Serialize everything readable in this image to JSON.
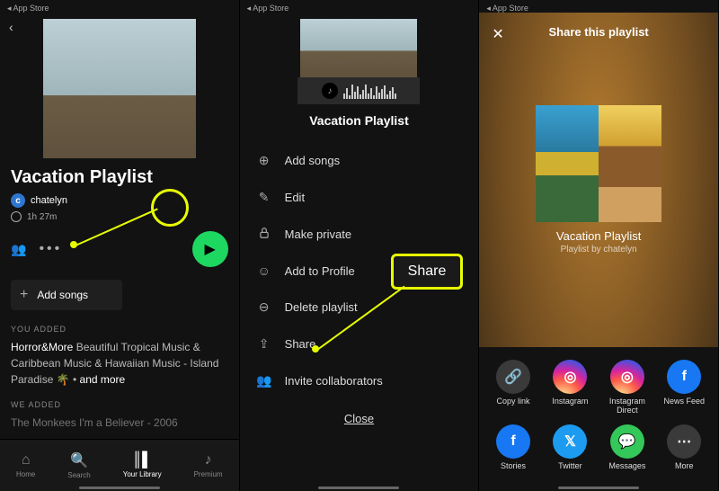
{
  "status_bar": "App Store",
  "screen1": {
    "title": "Vacation Playlist",
    "author_initial": "c",
    "author": "chatelyn",
    "duration": "1h 27m",
    "add_songs": "Add songs",
    "you_added": "YOU ADDED",
    "track1_name": "Horror&More",
    "track1_rest": "Beautiful Tropical Music & Caribbean Music & Hawaiian Music - Island Paradise 🌴  • ",
    "and_more": "and more",
    "we_added": "WE ADDED",
    "track2": "The Monkees I'm a Believer - 2006",
    "tabs": {
      "home": "Home",
      "search": "Search",
      "library": "Your Library",
      "premium": "Premium"
    }
  },
  "screen2": {
    "title": "Vacation Playlist",
    "add_songs": "Add songs",
    "edit": "Edit",
    "make_private": "Make private",
    "add_profile": "Add to Profile",
    "delete": "Delete playlist",
    "share": "Share",
    "invite": "Invite collaborators",
    "close": "Close",
    "callout": "Share"
  },
  "screen3": {
    "header": "Share this playlist",
    "name": "Vacation Playlist",
    "byline": "Playlist by chatelyn",
    "opts": {
      "copy": "Copy link",
      "ig": "Instagram",
      "igd": "Instagram Direct",
      "nf": "News Feed",
      "stories": "Stories",
      "tw": "Twitter",
      "msg": "Messages",
      "more": "More"
    }
  }
}
